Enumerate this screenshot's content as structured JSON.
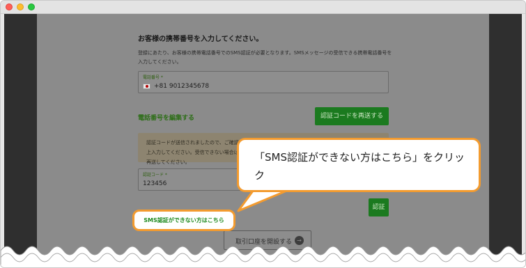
{
  "page": {
    "heading": "お客様の携帯番号を入力してください。",
    "description": "登録にあたり、お客様の携帯電話番号でのSMS認証が必要となります。SMSメッセージの受信できる携帯電話番号を入力してください。",
    "phone_field": {
      "label": "電話番号 *",
      "value": "+81  9012345678"
    },
    "edit_phone_link": "電話番号を編集する",
    "resend_button": "認証コードを再送する",
    "notice": "認証コードが送信されましたので、ご確認の上入力してください。受信できない場合は、再送してください。",
    "code_field": {
      "label": "認証コード *",
      "value": "123456"
    },
    "verify_button": "認証",
    "sms_link": "SMS認証ができない方はこちら",
    "open_account_button": "取引口座を開設する",
    "open_account_arrow": "→"
  },
  "callout": {
    "text": "「SMS認証ができない方はこちら」をクリック"
  },
  "colors": {
    "highlight": "#f39b2f",
    "green": "#1b7a1f",
    "link_green": "#1f8a1f",
    "overlay": "#8b8b8b"
  }
}
